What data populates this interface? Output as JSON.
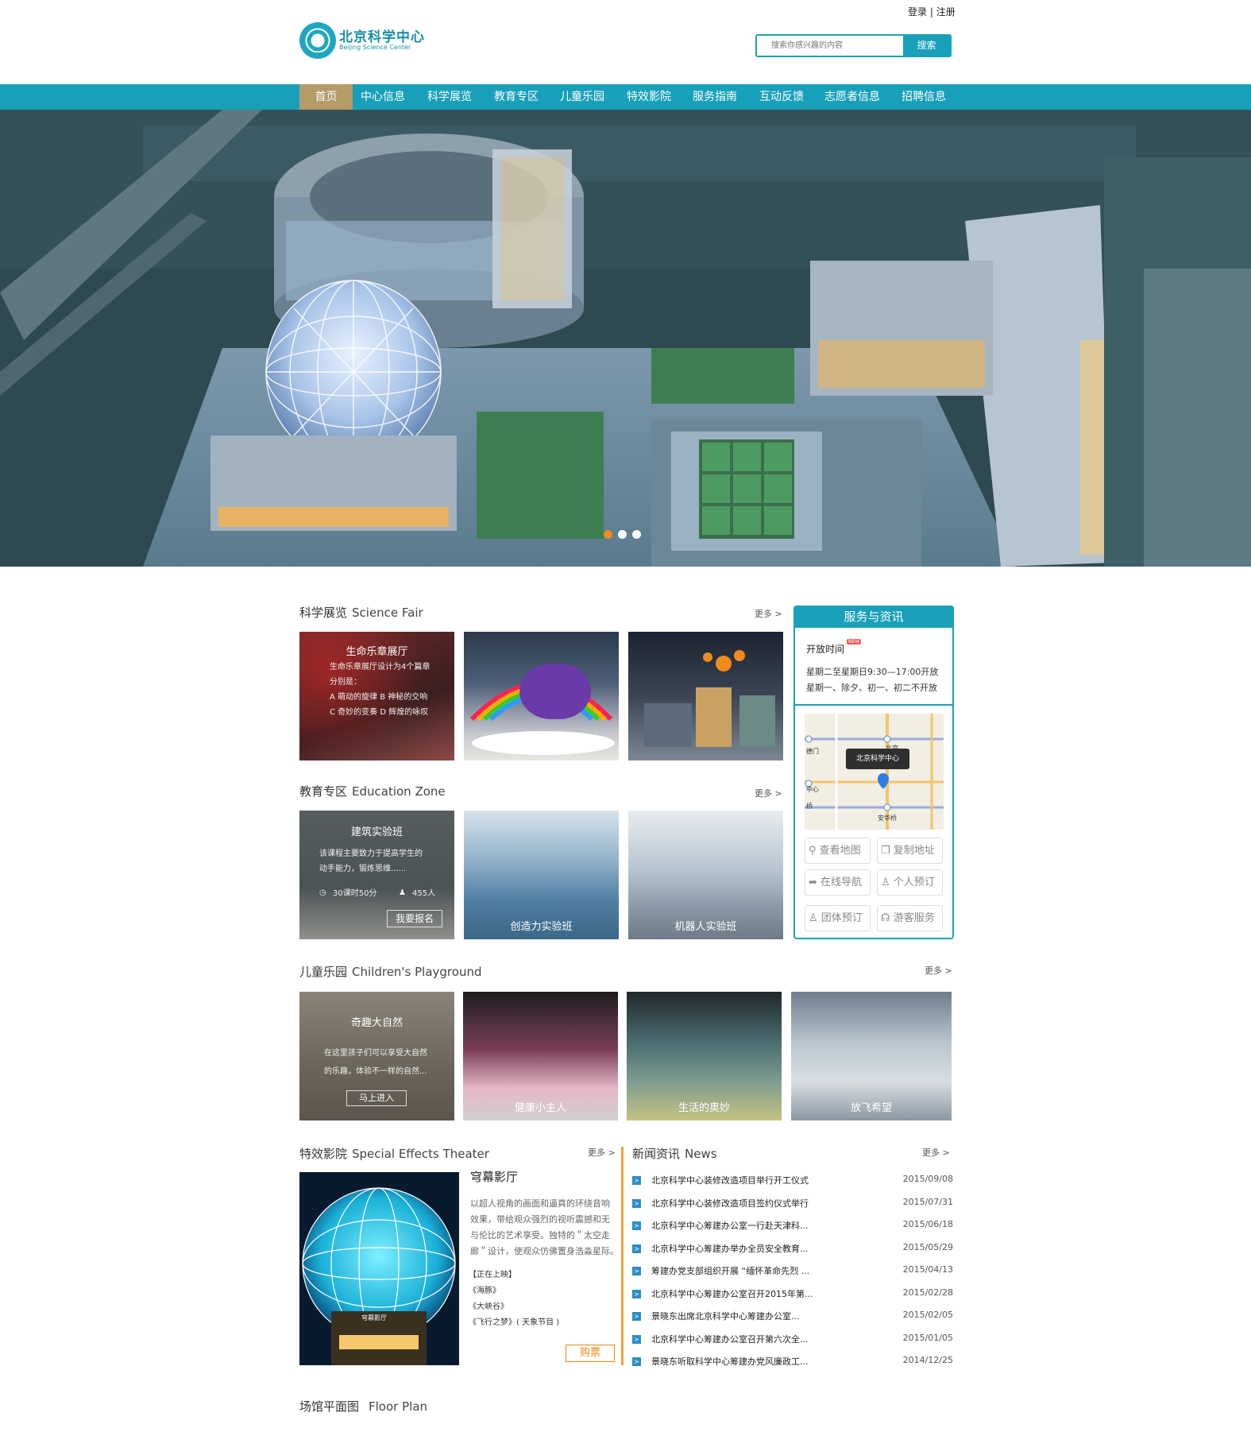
{
  "header": {
    "login": "登录",
    "register": "注册",
    "logo_cn": "北京科学中心",
    "logo_en": "Beijing Science Center",
    "search_placeholder": "搜索你感兴趣的内容",
    "search_button": "搜索"
  },
  "nav": [
    "首页",
    "中心信息",
    "科学展览",
    "教育专区",
    "儿童乐园",
    "特效影院",
    "服务指南",
    "互动反馈",
    "志愿者信息",
    "招聘信息"
  ],
  "nav_active_index": 0,
  "colors": {
    "brand": "#18a0ba",
    "nav_active": "#b59a6a",
    "ticket": "#e8850f"
  },
  "banner": {
    "slides": 3,
    "active_slide": 1
  },
  "science_fair": {
    "title": "科学展览",
    "title_en": "Science Fair",
    "more": "更多 >",
    "items": [
      {
        "title": "生命乐章展厅",
        "lines": [
          "生命乐章展厅设计为4个篇章",
          "分别是：",
          "A 萌动的旋律 B 神秘的交响",
          "C 奇妙的变奏 D 辉煌的咏叹"
        ]
      },
      {
        "title": ""
      },
      {
        "title": ""
      }
    ]
  },
  "education_zone": {
    "title": "教育专区",
    "title_en": "Education Zone",
    "more": "更多 >",
    "featured": {
      "title": "建筑实验班",
      "desc1": "该课程主要致力于提高学生的",
      "desc2": "动手能力，锻炼思维......",
      "hours": "30课时50分",
      "people": "455人",
      "button": "我要报名"
    },
    "items": [
      "创造力实验班",
      "机器人实验班"
    ]
  },
  "service": {
    "title": "服务与资讯",
    "hours_label": "开放时间",
    "new_badge": "NEW",
    "hours_1": "星期二至星期日9:30—17:00开放",
    "hours_2": "星期一、除夕、初一、初二不开放",
    "map_label": "北京科学中心",
    "map_tl": "德门",
    "map_ml": "中心",
    "map_bl": "桥",
    "map_br": "安华桥",
    "map_tr": "北京",
    "buttons": [
      "查看地图",
      "复制地址",
      "在线导航",
      "个人预订",
      "团体预订",
      "游客服务"
    ]
  },
  "playground": {
    "title": "儿童乐园",
    "title_en": "Children's  Playground",
    "more": "更多 >",
    "featured": {
      "title": "奇趣大自然",
      "line1": "在这里孩子们可以享受大自然",
      "line2": "的乐趣，体验不一样的自然...",
      "button": "马上进入"
    },
    "items": [
      "健康小主人",
      "生活的奥妙",
      "放飞希望"
    ]
  },
  "theater": {
    "title": "特效影院",
    "title_en": "Special Effects Theater",
    "more": "更多 >",
    "name": "穹幕影厅",
    "desc": [
      "以超人视角的画面和逼真的环绕音响",
      "效果，带给观众强烈的视听震撼和无",
      "与伦比的艺术享受。独特的＂太空走",
      "廊＂设计，使观众仿佛置身浩淼星际。"
    ],
    "now_showing": "【正在上映】",
    "films": [
      "《海豚》",
      "《大峡谷》",
      "《飞行之梦》( 天象节目 )"
    ],
    "ticket": "购票",
    "dome_sign": "穹幕影厅"
  },
  "news": {
    "title": "新闻资讯",
    "title_en": "News",
    "more": "更多 >",
    "items": [
      {
        "t": "北京科学中心装修改造项目举行开工仪式",
        "d": "2015/09/08"
      },
      {
        "t": "北京科学中心装修改造项目签约仪式举行",
        "d": "2015/07/31"
      },
      {
        "t": "北京科学中心筹建办公室一行赴天津科...",
        "d": "2015/06/18"
      },
      {
        "t": "北京科学中心筹建办举办全员安全教育...",
        "d": "2015/05/29"
      },
      {
        "t": "筹建办党支部组织开展 “缅怀革命先烈 ...",
        "d": "2015/04/13"
      },
      {
        "t": "北京科学中心筹建办公室召开2015年第...",
        "d": "2015/02/28"
      },
      {
        "t": "景晓东出席北京科学中心筹建办公室...",
        "d": "2015/02/05"
      },
      {
        "t": "北京科学中心筹建办公室召开第六次全...",
        "d": "2015/01/05"
      },
      {
        "t": "景晓东听取科学中心筹建办党风廉政工...",
        "d": "2014/12/25"
      }
    ]
  },
  "floor_plan": {
    "title": "场馆平面图",
    "title_en": "Floor Plan"
  }
}
